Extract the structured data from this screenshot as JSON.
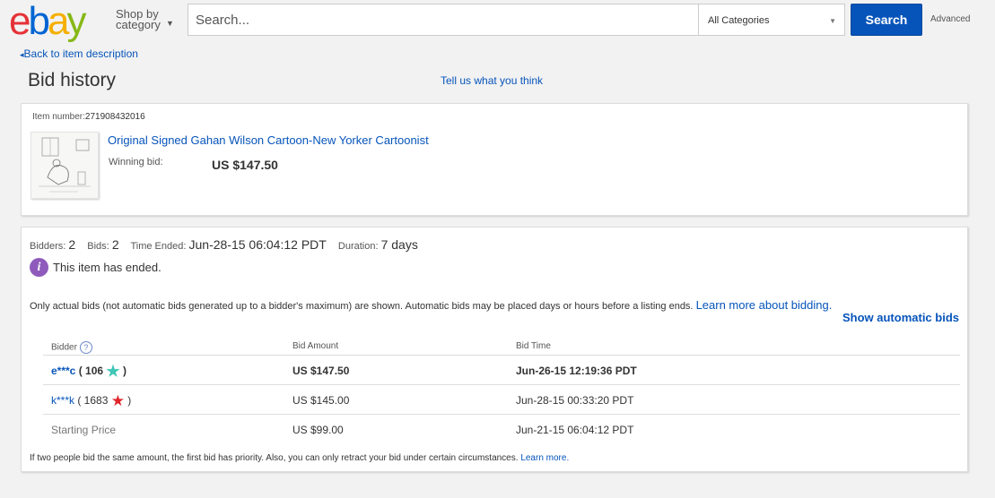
{
  "header": {
    "logo": {
      "l1": "e",
      "l2": "b",
      "l3": "a",
      "l4": "y"
    },
    "shop_by_line1": "Shop by",
    "shop_by_line2": "category",
    "search_placeholder": "Search...",
    "category_selected": "All Categories",
    "search_button": "Search",
    "advanced": "Advanced"
  },
  "nav": {
    "back_link": "Back to item description",
    "page_title": "Bid history",
    "feedback_link": "Tell us what you think"
  },
  "item": {
    "number_label": "Item number:",
    "number": "271908432016",
    "title": "Original Signed Gahan Wilson Cartoon-New Yorker Cartoonist",
    "winning_bid_label": "Winning bid:",
    "winning_bid": "US $147.50"
  },
  "summary": {
    "bidders_label": "Bidders:",
    "bidders": "2",
    "bids_label": "Bids:",
    "bids": "2",
    "time_ended_label": "Time Ended:",
    "time_ended": "Jun-28-15 06:04:12 PDT",
    "duration_label": "Duration:",
    "duration": "7 days",
    "ended_message": "This item has ended."
  },
  "note": {
    "text": "Only actual bids (not automatic bids generated up to a bidder's maximum) are shown. Automatic bids may be placed days or hours before a listing ends. ",
    "learn_link": "Learn more about bidding.",
    "show_automatic": "Show automatic bids"
  },
  "table": {
    "headers": {
      "bidder": "Bidder",
      "amount": "Bid Amount",
      "time": "Bid Time"
    },
    "rows": [
      {
        "bidder": "e***c",
        "feedback_open": " ( 106 ",
        "feedback_close": " )",
        "amount": "US $147.50",
        "time": "Jun-26-15 12:19:36 PDT"
      },
      {
        "bidder": "k***k",
        "feedback_open": " ( 1683 ",
        "feedback_close": " )",
        "amount": "US $145.00",
        "time": "Jun-28-15 00:33:20 PDT"
      },
      {
        "bidder": "Starting Price",
        "amount": "US $99.00",
        "time": "Jun-21-15 06:04:12 PDT"
      }
    ]
  },
  "footer": {
    "text": "If two people bid the same amount, the first bid has priority. Also, you can only retract your bid under certain circumstances. ",
    "learn_link": "Learn more."
  },
  "colors": {
    "link": "#0654ba",
    "search_button": "#0654ba",
    "info_icon": "#8e5bbd",
    "star_turquoise": "#3fc6b6",
    "star_red": "#e0252b"
  },
  "icons": {
    "back": "chevron-left-icon",
    "info": "info-icon",
    "help": "question-icon",
    "star1": "turquoise-star-icon",
    "star2": "red-star-icon"
  }
}
